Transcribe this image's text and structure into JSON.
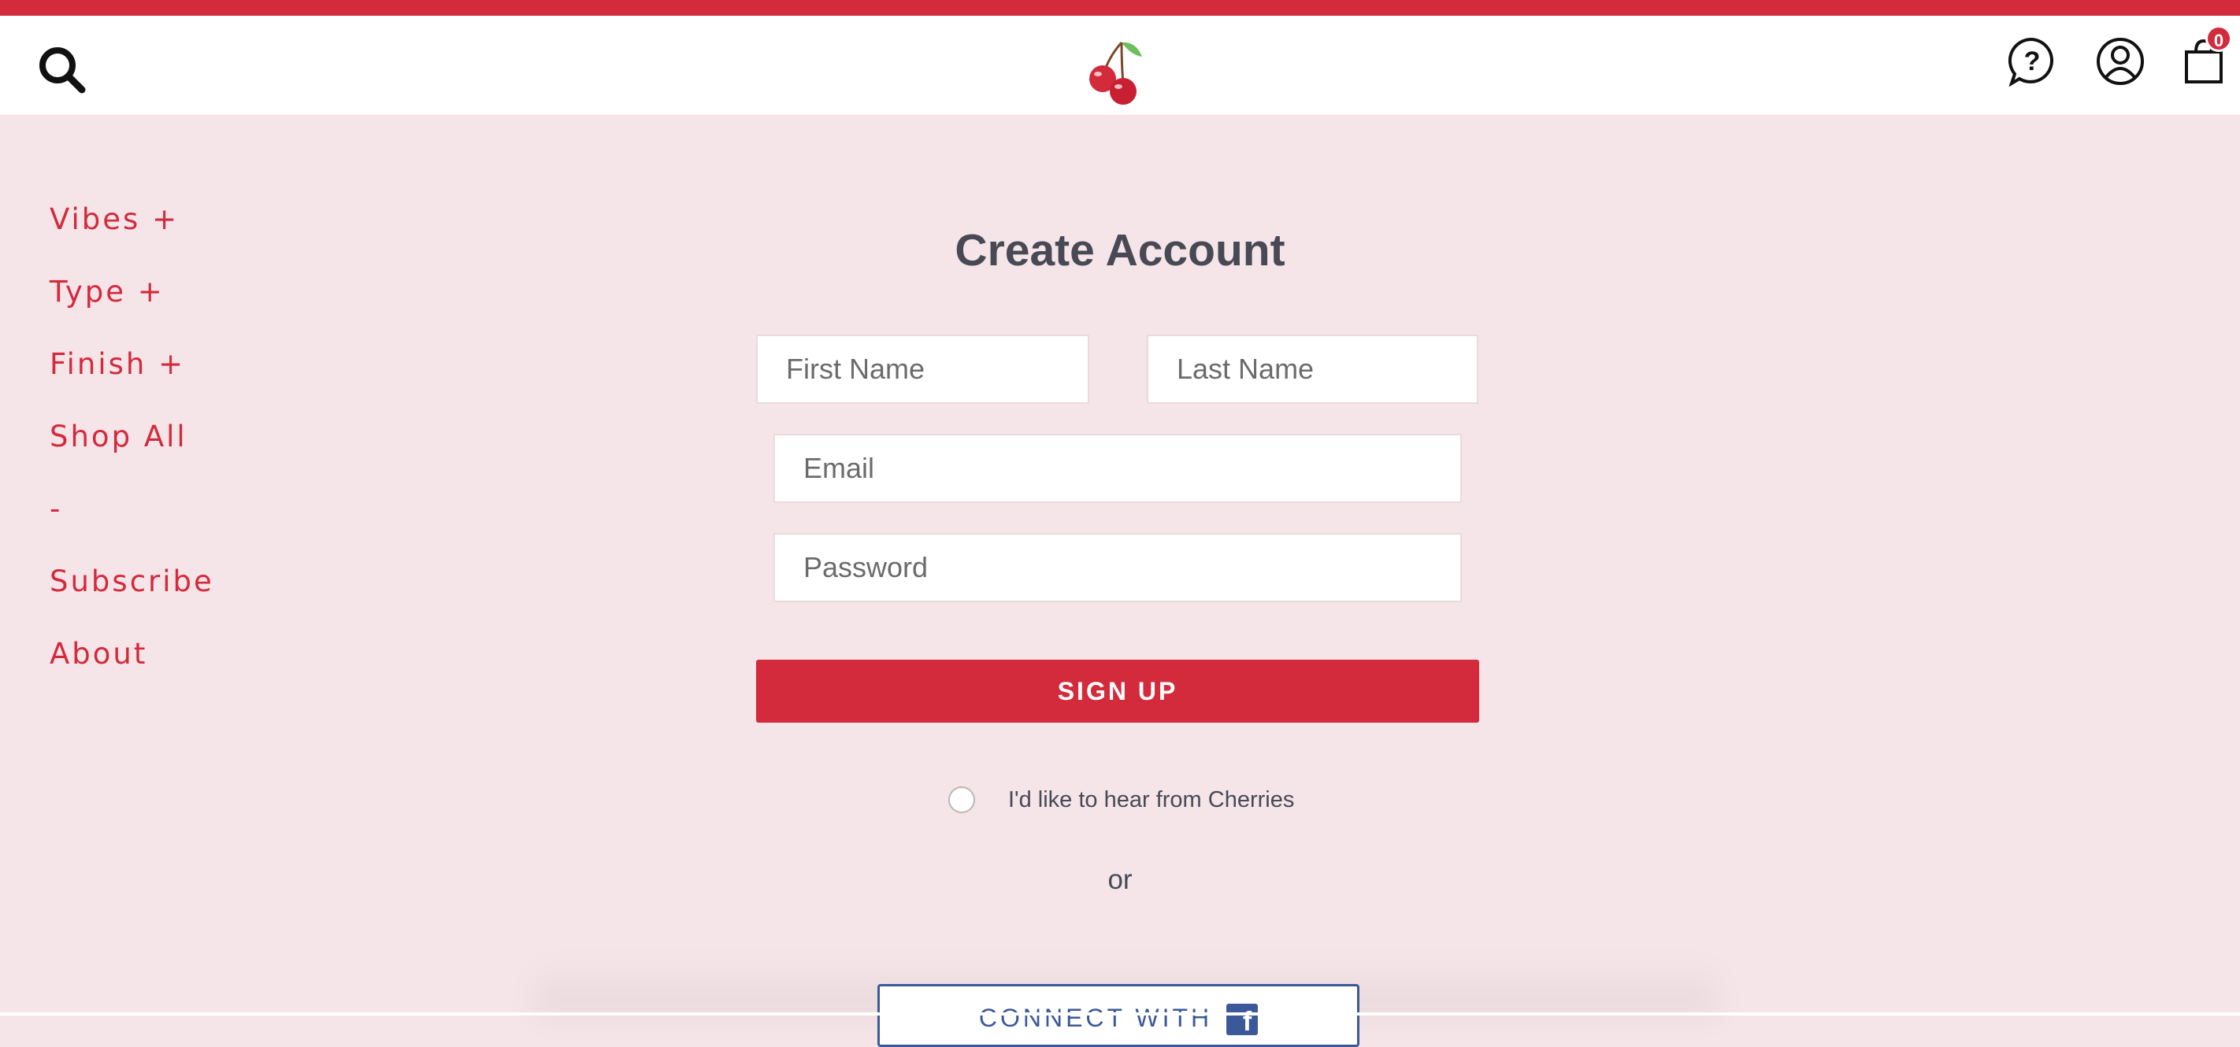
{
  "header": {
    "cart_count": "0",
    "icons": {
      "search": "search-icon",
      "logo": "cherries-logo",
      "help": "help-chat-icon",
      "account": "user-account-icon",
      "cart": "shopping-bag-icon"
    }
  },
  "nav": {
    "items": [
      {
        "label": "Vibes +"
      },
      {
        "label": "Type +"
      },
      {
        "label": "Finish +"
      },
      {
        "label": "Shop All"
      },
      {
        "label": "-"
      },
      {
        "label": "Subscribe"
      },
      {
        "label": "About"
      }
    ]
  },
  "form": {
    "title": "Create Account",
    "first_name_placeholder": "First Name",
    "last_name_placeholder": "Last Name",
    "email_placeholder": "Email",
    "password_placeholder": "Password",
    "submit_label": "SIGN UP",
    "opt_in_label": "I'd like to hear from Cherries",
    "opt_in_checked": false,
    "or_label": "or",
    "facebook_label": "CONNECT WITH",
    "facebook_logo": "f"
  },
  "colors": {
    "accent": "#d32a3c",
    "background": "#f5e4e8",
    "title_text": "#474a55",
    "facebook": "#3b5998"
  }
}
